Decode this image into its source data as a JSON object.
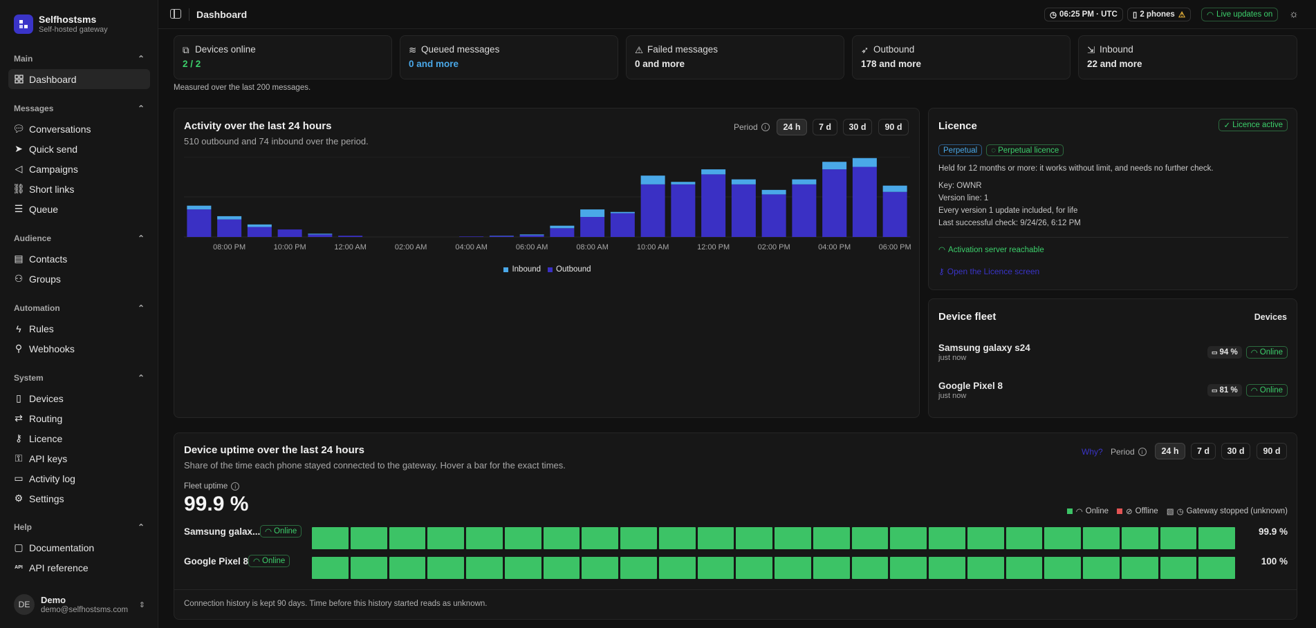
{
  "app": {
    "name": "Selfhostsms",
    "tagline": "Self-hosted gateway"
  },
  "sidebar": {
    "groups": [
      {
        "title": "Main",
        "items": [
          {
            "label": "Dashboard",
            "icon": "dashboard-icon",
            "active": true
          }
        ]
      },
      {
        "title": "Messages",
        "items": [
          {
            "label": "Conversations",
            "icon": "conversations-icon"
          },
          {
            "label": "Quick send",
            "icon": "send-icon"
          },
          {
            "label": "Campaigns",
            "icon": "megaphone-icon"
          },
          {
            "label": "Short links",
            "icon": "link-icon"
          },
          {
            "label": "Queue",
            "icon": "queue-icon"
          }
        ]
      },
      {
        "title": "Audience",
        "items": [
          {
            "label": "Contacts",
            "icon": "contacts-icon"
          },
          {
            "label": "Groups",
            "icon": "groups-icon"
          }
        ]
      },
      {
        "title": "Automation",
        "items": [
          {
            "label": "Rules",
            "icon": "bolt-icon"
          },
          {
            "label": "Webhooks",
            "icon": "webhook-icon"
          }
        ]
      },
      {
        "title": "System",
        "items": [
          {
            "label": "Devices",
            "icon": "device-icon"
          },
          {
            "label": "Routing",
            "icon": "routing-icon"
          },
          {
            "label": "Licence",
            "icon": "key-icon"
          },
          {
            "label": "API keys",
            "icon": "api-key-icon"
          },
          {
            "label": "Activity log",
            "icon": "log-icon"
          },
          {
            "label": "Settings",
            "icon": "gear-icon"
          }
        ]
      },
      {
        "title": "Help",
        "items": [
          {
            "label": "Documentation",
            "icon": "book-icon"
          },
          {
            "label": "API reference",
            "icon": "api-icon"
          }
        ]
      }
    ],
    "user": {
      "initials": "DE",
      "name": "Demo",
      "email": "demo@selfhostsms.com"
    }
  },
  "topbar": {
    "title": "Dashboard",
    "time": "06:25 PM · UTC",
    "phones": "2 phones",
    "live": "Live updates on"
  },
  "stats": [
    {
      "label": "Devices online",
      "value": "2 / 2",
      "color": "#3ccf6b",
      "icon": "devices-icon"
    },
    {
      "label": "Queued messages",
      "value": "0 and more",
      "color": "#4aa8e8",
      "icon": "layers-icon"
    },
    {
      "label": "Failed messages",
      "value": "0 and more",
      "color": "#f0f0f0",
      "icon": "warning-icon"
    },
    {
      "label": "Outbound",
      "value": "178 and more",
      "color": "#f0f0f0",
      "icon": "send-icon"
    },
    {
      "label": "Inbound",
      "value": "22 and more",
      "color": "#f0f0f0",
      "icon": "inbound-icon"
    }
  ],
  "stats_note": "Measured over the last 200 messages.",
  "activity": {
    "title": "Activity over the last 24 hours",
    "subtitle": "510 outbound and 74 inbound over the period.",
    "period_label": "Period",
    "periods": [
      "24 h",
      "7 d",
      "30 d",
      "90 d"
    ],
    "active_period": "24 h"
  },
  "chart_data": {
    "type": "bar",
    "stacked": true,
    "x_tick_labels": [
      "08:00 PM",
      "10:00 PM",
      "12:00 AM",
      "02:00 AM",
      "04:00 AM",
      "06:00 AM",
      "08:00 AM",
      "10:00 AM",
      "12:00 PM",
      "02:00 PM",
      "04:00 PM",
      "06:00 PM"
    ],
    "series": [
      {
        "name": "Outbound",
        "color": "#3a30c4",
        "values": [
          11,
          7,
          4,
          3,
          1,
          0.5,
          0,
          0,
          0,
          0.2,
          0.4,
          0.7,
          3.5,
          8,
          9.5,
          21,
          21,
          25,
          21,
          17,
          21,
          27,
          28,
          18
        ]
      },
      {
        "name": "Inbound",
        "color": "#4aa8e8",
        "values": [
          1.5,
          1.3,
          1,
          0,
          0.3,
          0,
          0,
          0,
          0,
          0,
          0.1,
          0.3,
          1,
          3,
          0.5,
          3.5,
          1,
          2,
          2,
          1.8,
          2,
          3,
          3.5,
          2.5
        ]
      }
    ],
    "legend": [
      "Inbound",
      "Outbound"
    ],
    "legend_position": "bottom",
    "ylim": [
      0,
      32
    ],
    "grid": true
  },
  "licence": {
    "title": "Licence",
    "status": "Licence active",
    "badge1": "Perpetual",
    "badge2": "Perpetual licence",
    "description": "Held for 12 months or more: it works without limit, and needs no further check.",
    "key": "Key: OWNR",
    "version": "Version line: 1",
    "updates": "Every version 1 update included, for life",
    "last_check": "Last successful check: 9/24/26, 6:12 PM",
    "server": "Activation server reachable",
    "link": "Open the Licence screen"
  },
  "fleet": {
    "title": "Device fleet",
    "action": "Devices",
    "devices": [
      {
        "name": "Samsung galaxy s24",
        "seen": "just now",
        "battery": "94 %",
        "status": "Online"
      },
      {
        "name": "Google Pixel 8",
        "seen": "just now",
        "battery": "81 %",
        "status": "Online"
      }
    ]
  },
  "uptime": {
    "title": "Device uptime over the last 24 hours",
    "subtitle": "Share of the time each phone stayed connected to the gateway. Hover a bar for the exact times.",
    "why": "Why?",
    "period_label": "Period",
    "periods": [
      "24 h",
      "7 d",
      "30 d",
      "90 d"
    ],
    "active_period": "24 h",
    "fleet_label": "Fleet uptime",
    "fleet_value": "99.9 %",
    "legend": {
      "online": "Online",
      "offline": "Offline",
      "stopped": "Gateway stopped (unknown)"
    },
    "rows": [
      {
        "name": "Samsung galax...",
        "status": "Online",
        "value": "99.9 %",
        "segments": 24
      },
      {
        "name": "Google Pixel 8",
        "status": "Online",
        "value": "100 %",
        "segments": 24
      }
    ],
    "footer": "Connection history is kept 90 days. Time before this history started reads as unknown."
  }
}
